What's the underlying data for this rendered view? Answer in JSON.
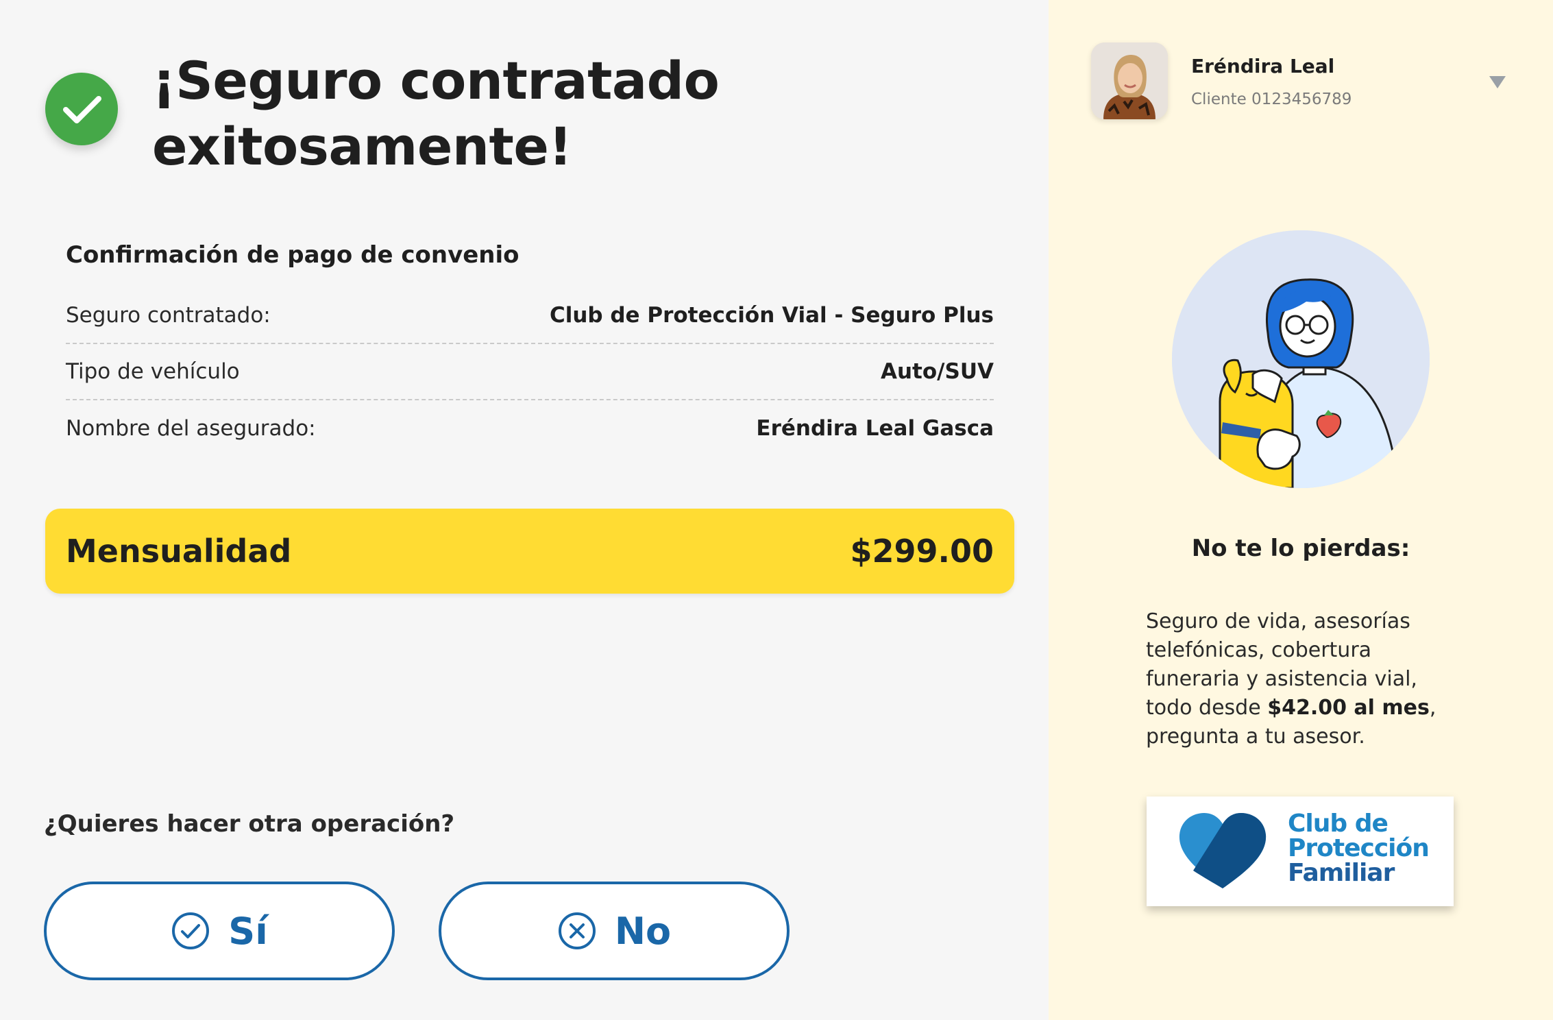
{
  "header": {
    "title": "¡Seguro contratado exitosamente!",
    "success_icon": "check-circle-icon"
  },
  "confirmation": {
    "section_title": "Confirmación de pago de convenio",
    "rows": [
      {
        "label": "Seguro contratado:",
        "value": "Club de Protección Vial - Seguro Plus"
      },
      {
        "label": "Tipo de vehículo",
        "value": "Auto/SUV"
      },
      {
        "label": "Nombre del asegurado:",
        "value": "Eréndira Leal Gasca"
      }
    ],
    "monthly": {
      "label": "Mensualidad",
      "value": "$299.00"
    }
  },
  "question": {
    "text": "¿Quieres hacer otra operación?",
    "yes_label": "Sí",
    "no_label": "No"
  },
  "user": {
    "name": "Eréndira Leal",
    "client_id": "Cliente 0123456789"
  },
  "promo": {
    "title": "No te lo pierdas:",
    "text_before": "Seguro de vida, asesorías telefónicas, cobertura funeraria y asistencia vial, todo desde ",
    "price": "$42.00 al mes",
    "text_after": ", pregunta a tu asesor."
  },
  "brand": {
    "line1": "Club de",
    "line2": "Protección",
    "line3": "Familiar"
  },
  "colors": {
    "success": "#45a848",
    "accent_yellow": "#ffdc33",
    "button_blue": "#1a67a8",
    "sidebar_bg": "#fff8e1"
  }
}
